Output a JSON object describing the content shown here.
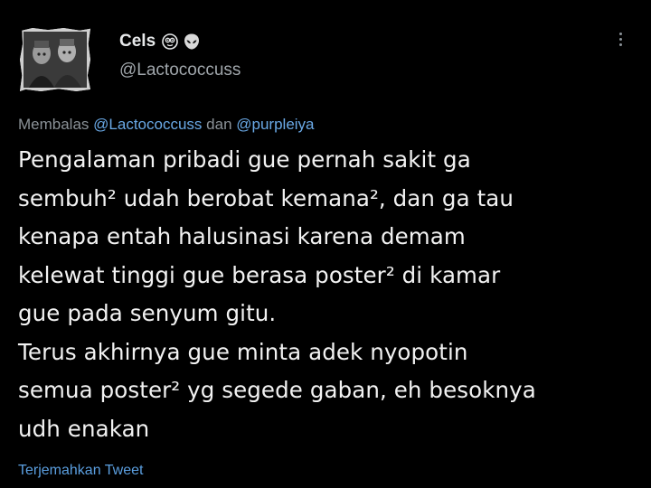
{
  "tweet": {
    "author": {
      "display_name": "Cels",
      "handle": "@Lactococcuss",
      "emoji_icons": [
        "smiley-face-icon",
        "alien-icon"
      ]
    },
    "reply_context": {
      "prefix": "Membalas",
      "mention_1": "@Lactococcuss",
      "conjunction": "dan",
      "mention_2": "@purpleiya"
    },
    "body_lines": [
      "Pengalaman pribadi gue pernah sakit ga",
      "sembuh² udah berobat kemana², dan ga tau",
      "kenapa entah halusinasi karena demam",
      "kelewat tinggi gue berasa poster² di kamar",
      "gue pada senyum gitu.",
      "Terus akhirnya gue minta adek nyopotin",
      "semua poster² yg segede gaban, eh besoknya",
      "udh enakan"
    ],
    "translate_label": "Terjemahkan Tweet"
  },
  "colors": {
    "background": "#000000",
    "primary_text": "#e7e9ea",
    "secondary_text": "#8b9298",
    "link": "#6aa9e6"
  }
}
